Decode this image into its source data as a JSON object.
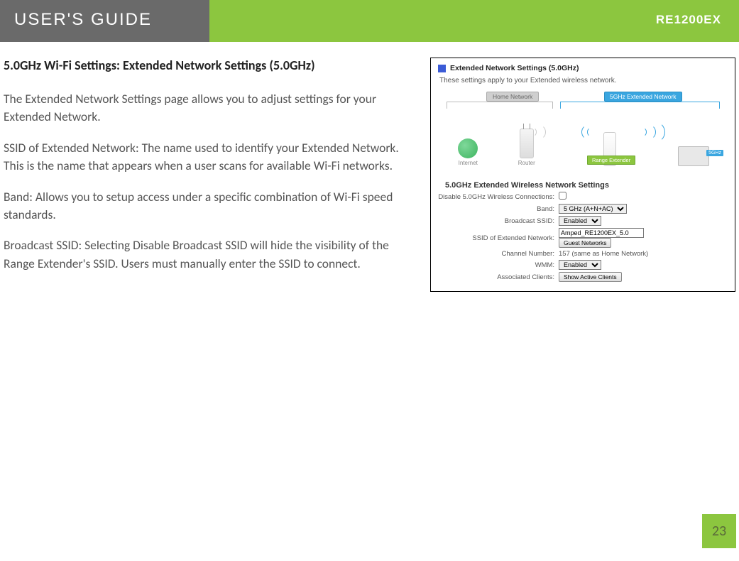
{
  "header": {
    "left": "USER'S GUIDE",
    "right": "RE1200EX"
  },
  "section_title": "5.0GHz Wi-Fi Settings: Extended Network Settings (5.0GHz)",
  "paragraphs": {
    "p1": "The Extended Network Settings page allows you to adjust settings for your Extended Network.",
    "p2": "SSID of Extended Network: The name used to identify your Extended Network. This is the name that appears when a user scans for available Wi-Fi networks.",
    "p3": "Band: Allows you to setup access under a specific combination of Wi-Fi speed standards.",
    "p4": "Broadcast SSID: Selecting Disable Broadcast SSID will hide the visibility of the Range Extender's SSID. Users must manually enter the SSID to connect."
  },
  "screenshot": {
    "title": "Extended Network Settings (5.0GHz)",
    "subtitle": "These settings apply to your Extended wireless network.",
    "diagram": {
      "home_label": "Home Network",
      "ext_label": "5GHz Extended Network",
      "internet": "Internet",
      "router": "Router",
      "range_ext": "Range Extender",
      "band_tag": "5GHz"
    },
    "form_title": "5.0GHz Extended Wireless Network Settings",
    "labels": {
      "disable": "Disable 5.0GHz Wireless Connections:",
      "band": "Band:",
      "broadcast": "Broadcast SSID:",
      "ssid": "SSID of Extended Network:",
      "channel": "Channel Number:",
      "wmm": "WMM:",
      "clients": "Associated Clients:"
    },
    "values": {
      "band": "5 GHz (A+N+AC)",
      "broadcast": "Enabled",
      "ssid": "Amped_RE1200EX_5.0",
      "guest_btn": "Guest Networks",
      "channel": "157 (same as Home Network)",
      "wmm": "Enabled",
      "clients_btn": "Show Active Clients"
    }
  },
  "page_number": "23"
}
